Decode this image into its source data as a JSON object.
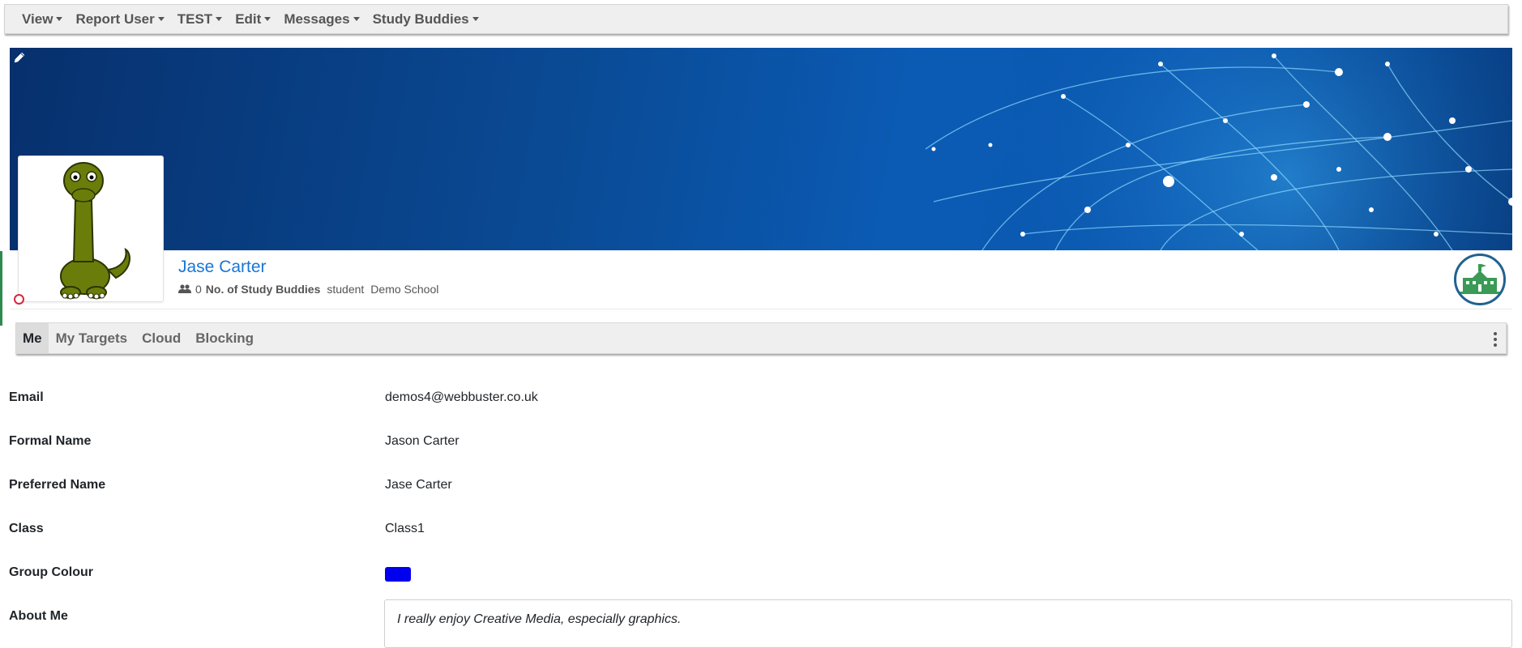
{
  "menu": {
    "items": [
      {
        "label": "View"
      },
      {
        "label": "Report User"
      },
      {
        "label": "TEST"
      },
      {
        "label": "Edit"
      },
      {
        "label": "Messages"
      },
      {
        "label": "Study Buddies"
      }
    ]
  },
  "profile": {
    "name": "Jase Carter",
    "buddy_count": "0",
    "buddy_label": "No. of Study Buddies",
    "role": "student",
    "school": "Demo School",
    "status_color": "#d9263c"
  },
  "tabs": [
    {
      "label": "Me",
      "active": true
    },
    {
      "label": "My Targets",
      "active": false
    },
    {
      "label": "Cloud",
      "active": false
    },
    {
      "label": "Blocking",
      "active": false
    }
  ],
  "details": {
    "email": {
      "label": "Email",
      "value": "demos4@webbuster.co.uk"
    },
    "formal_name": {
      "label": "Formal Name",
      "value": "Jason Carter"
    },
    "preferred_name": {
      "label": "Preferred Name",
      "value": "Jase Carter"
    },
    "class": {
      "label": "Class",
      "value": "Class1"
    },
    "group_colour": {
      "label": "Group Colour",
      "color": "#0000ee"
    },
    "about_me": {
      "label": "About Me",
      "value": "I really enjoy Creative Media, especially graphics."
    }
  },
  "colors": {
    "accent": "#1877d6",
    "banner": "#0b5bb5",
    "bar": "#efefef"
  }
}
